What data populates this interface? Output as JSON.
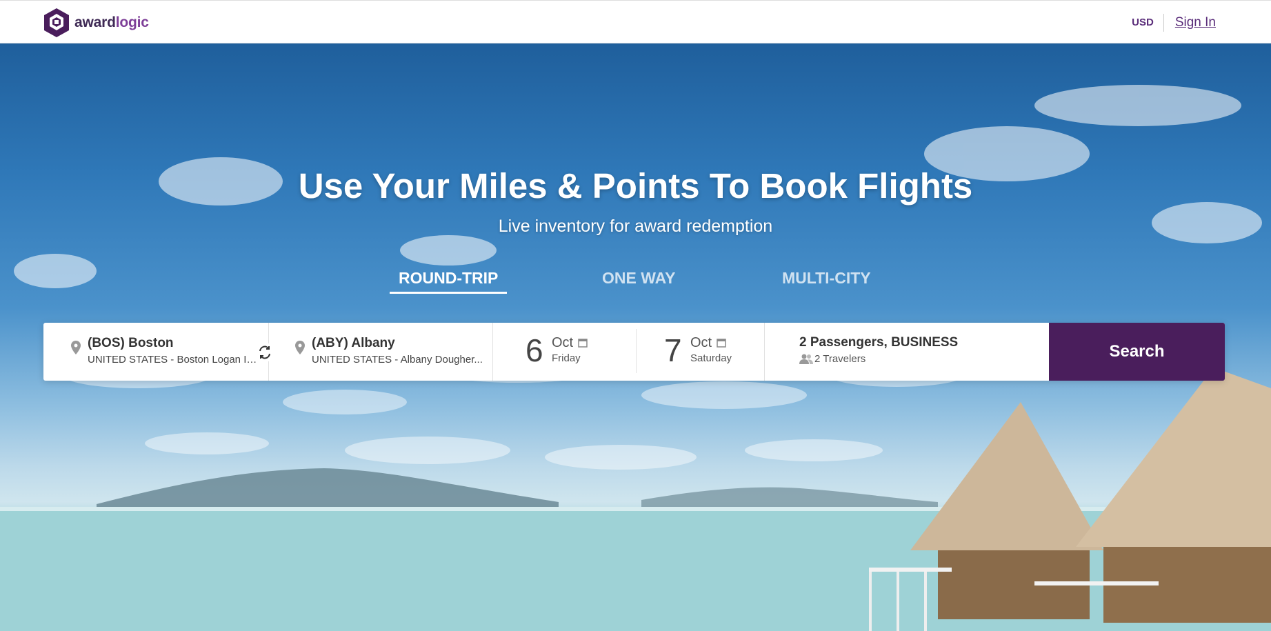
{
  "brand": {
    "name_part1": "award",
    "name_part2": "logic",
    "color": "#4a1e5c",
    "accent": "#7e3f98"
  },
  "header": {
    "currency": "USD",
    "signin_label": "Sign In"
  },
  "hero": {
    "title": "Use Your Miles & Points To Book Flights",
    "subtitle": "Live inventory for award redemption"
  },
  "tabs": [
    {
      "label": "ROUND-TRIP",
      "active": true
    },
    {
      "label": "ONE WAY",
      "active": false
    },
    {
      "label": "MULTI-CITY",
      "active": false
    }
  ],
  "search": {
    "from": {
      "code_city": "(BOS) Boston",
      "detail": "UNITED STATES - Boston Logan In..."
    },
    "to": {
      "code_city": "(ABY) Albany",
      "detail": "UNITED STATES - Albany Dougher..."
    },
    "depart": {
      "day": "6",
      "month": "Oct",
      "weekday": "Friday"
    },
    "return": {
      "day": "7",
      "month": "Oct",
      "weekday": "Saturday"
    },
    "passengers": {
      "summary": "2 Passengers, BUSINESS",
      "travelers": "2 Travelers"
    },
    "button_label": "Search"
  },
  "icons": {
    "location": "map-pin-icon",
    "swap": "swap-icon",
    "calendar": "calendar-icon",
    "travelers": "people-icon"
  }
}
